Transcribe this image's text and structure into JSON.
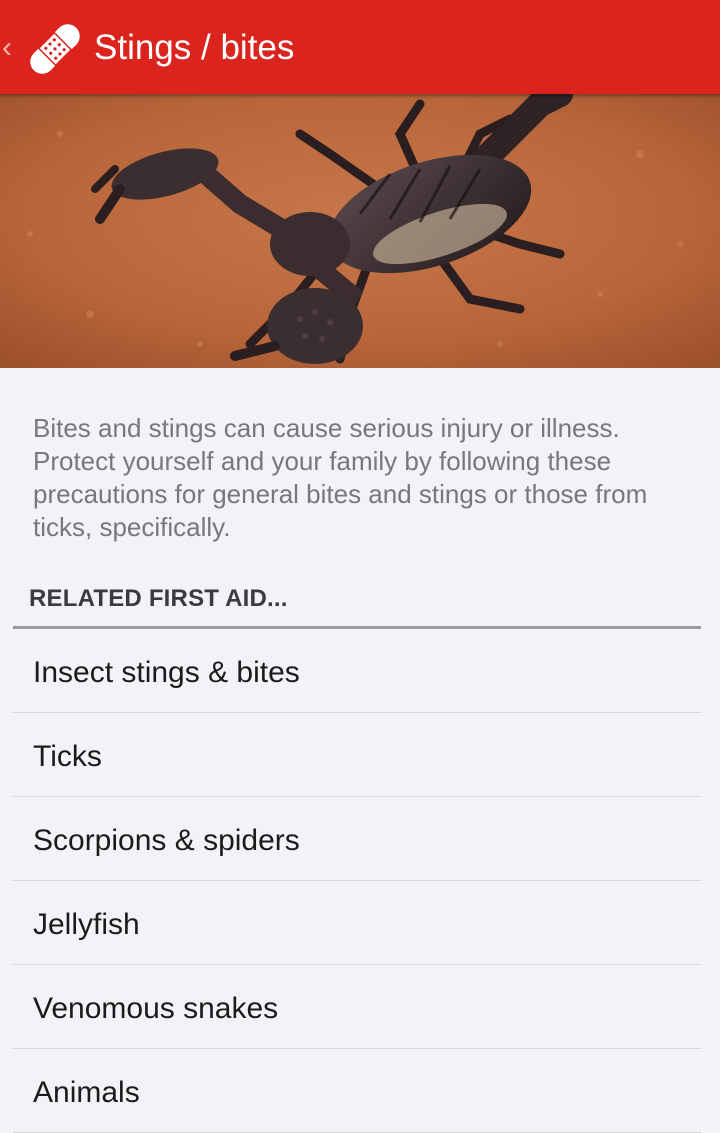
{
  "appbar": {
    "back_glyph": "‹",
    "title": "Stings / bites",
    "color": "#dc241f"
  },
  "hero": {
    "icon": "scorpion-photo"
  },
  "description": "Bites and stings can cause serious injury or illness. Protect yourself and your family by following these precautions for general bites and stings or those from ticks, specifically.",
  "related": {
    "header": "RELATED FIRST AID...",
    "items": [
      {
        "label": "Insect stings & bites"
      },
      {
        "label": "Ticks"
      },
      {
        "label": "Scorpions & spiders"
      },
      {
        "label": "Jellyfish"
      },
      {
        "label": "Venomous snakes"
      },
      {
        "label": "Animals"
      }
    ]
  }
}
